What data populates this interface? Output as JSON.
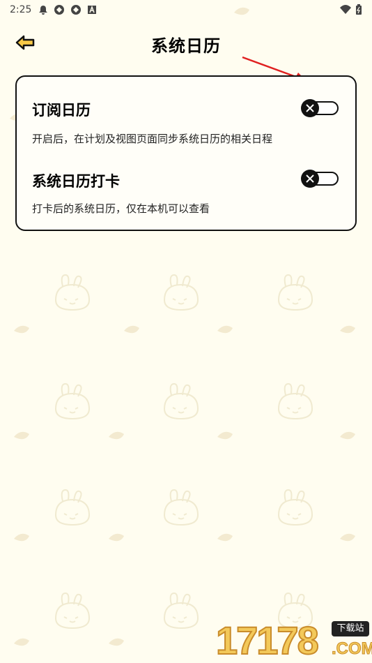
{
  "status_bar": {
    "time": "2:25",
    "icons_left": [
      "bell-icon",
      "app-icon",
      "app-icon",
      "a-icon"
    ],
    "icons_right": [
      "wifi-icon",
      "battery-icon"
    ]
  },
  "header": {
    "title": "系统日历",
    "back_icon": "back-arrow-icon"
  },
  "settings": [
    {
      "title": "订阅日历",
      "description": "开启后，在计划及视图页面同步系统日历的相关日程",
      "enabled": false
    },
    {
      "title": "系统日历打卡",
      "description": "打卡后的系统日历，仅在本机可以查看",
      "enabled": false
    }
  ],
  "watermark": {
    "digits": "17178",
    "badge": "下载站",
    "suffix": ".COM"
  },
  "colors": {
    "background": "#fffdf0",
    "accent_arrow": "#e02020",
    "toggle_off": "#111111",
    "watermark": "#f3c95a"
  }
}
